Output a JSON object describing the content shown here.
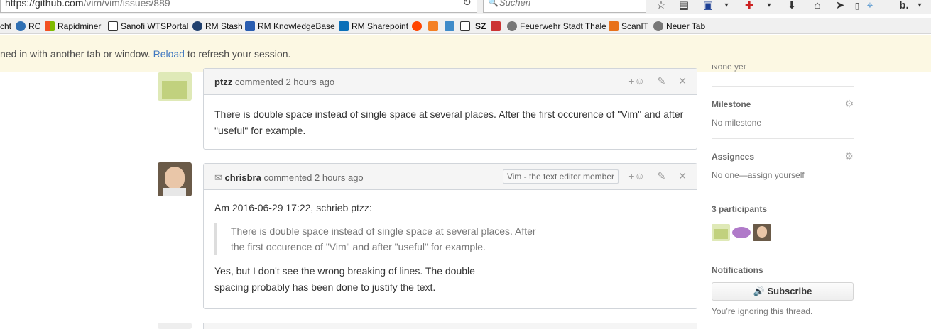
{
  "browser": {
    "url_host": "https://github.com",
    "url_path": "/vim/vim/issues/889",
    "search_placeholder": "Suchen",
    "bookmarks": [
      "cht",
      "RC",
      "Rapidminer",
      "Sanofi WTSPortal",
      "RM Stash",
      "RM KnowledgeBase",
      "RM Sharepoint",
      "SZ",
      "Feuerwehr Stadt Thale",
      "ScanIT",
      "Neuer Tab"
    ]
  },
  "flash": {
    "prefix": "ned in with another tab or window.",
    "link": "Reload",
    "suffix": " to refresh your session."
  },
  "comments": [
    {
      "author": "ptzz",
      "meta": "commented 2 hours ago",
      "body": "There is double space instead of single space at several places. After the first occurence of \"Vim\" and after \"useful\" for example."
    },
    {
      "author": "chrisbra",
      "meta": "commented 2 hours ago",
      "badge": "Vim - the text editor member",
      "intro": "Am 2016-06-29 17:22, schrieb ptzz:",
      "quote_line1": "There is double space instead of single space at several places. After",
      "quote_line2": "the first occurence of \"Vim\" and after \"useful\" for example.",
      "reply_line1": "Yes, but I don't see the wrong breaking of lines. The double",
      "reply_line2": "spacing probably has been done to justify the text."
    }
  ],
  "comment_actions": {
    "reaction": "+☺",
    "edit": "✎",
    "delete": "✕"
  },
  "sidebar": {
    "labels_partial": "None yet",
    "milestone_title": "Milestone",
    "milestone_value": "No milestone",
    "assignees_title": "Assignees",
    "assignees_value": "No one—assign yourself",
    "participants_title": "3 participants",
    "notifications_title": "Notifications",
    "subscribe_label": "Subscribe",
    "ignoring_text": "You’re ignoring this thread."
  },
  "colors": {
    "link": "#4078c0",
    "flash_bg": "#fcf8e3",
    "header_bg": "#f5f5f5",
    "border": "#d1d5da"
  }
}
